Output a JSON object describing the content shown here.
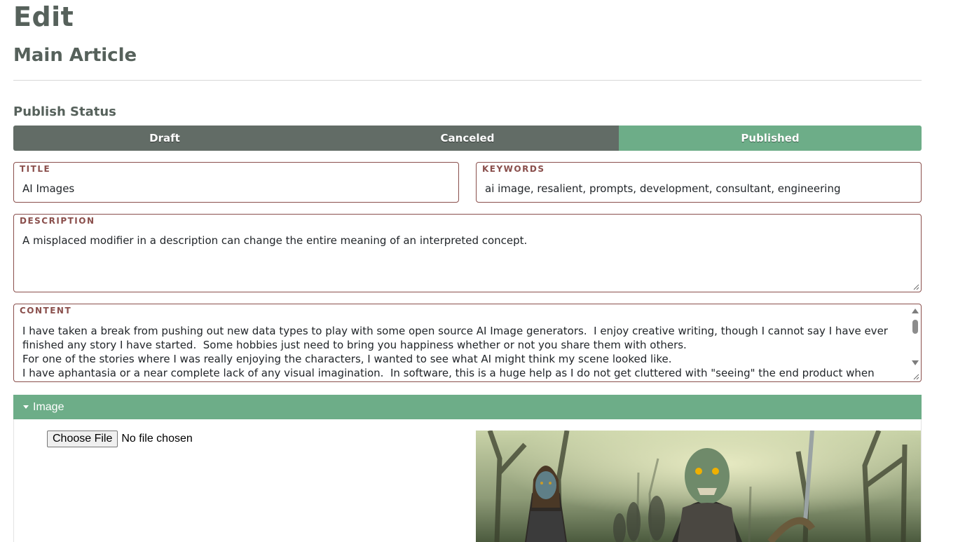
{
  "header": {
    "title": "Edit",
    "subtitle": "Main Article"
  },
  "publish_status": {
    "label": "Publish Status",
    "options": [
      {
        "label": "Draft",
        "active": false
      },
      {
        "label": "Canceled",
        "active": false
      },
      {
        "label": "Published",
        "active": true
      }
    ],
    "active_color": "#6dad88",
    "inactive_color": "#626c66"
  },
  "fields": {
    "title": {
      "label": "TITLE",
      "value": "AI Images"
    },
    "keywords": {
      "label": "KEYWORDS",
      "value": "ai image, resalient, prompts, development, consultant, engineering"
    },
    "description": {
      "label": "DESCRIPTION",
      "value": "A misplaced modifier in a description can change the entire meaning of an interpreted concept."
    },
    "content": {
      "label": "CONTENT",
      "value": "I have taken a break from pushing out new data types to play with some open source AI Image generators.  I enjoy creative writing, though I cannot say I have ever finished any story I have started.  Some hobbies just need to bring you happiness whether or not you share them with others.\nFor one of the stories where I was really enjoying the characters, I wanted to see what AI might think my scene looked like.\nI have aphantasia or a near complete lack of any visual imagination.  In software, this is a huge help as I do not get cluttered with \"seeing\" the end product when designing the"
    }
  },
  "image_section": {
    "header": "Image",
    "choose_file_label": "Choose File",
    "file_status": "No file chosen",
    "preview_description": "two undead armored warriors in a misty swamp forest"
  },
  "colors": {
    "heading": "#56615b",
    "field_border": "#8a4f4c",
    "accent": "#6dad88"
  }
}
